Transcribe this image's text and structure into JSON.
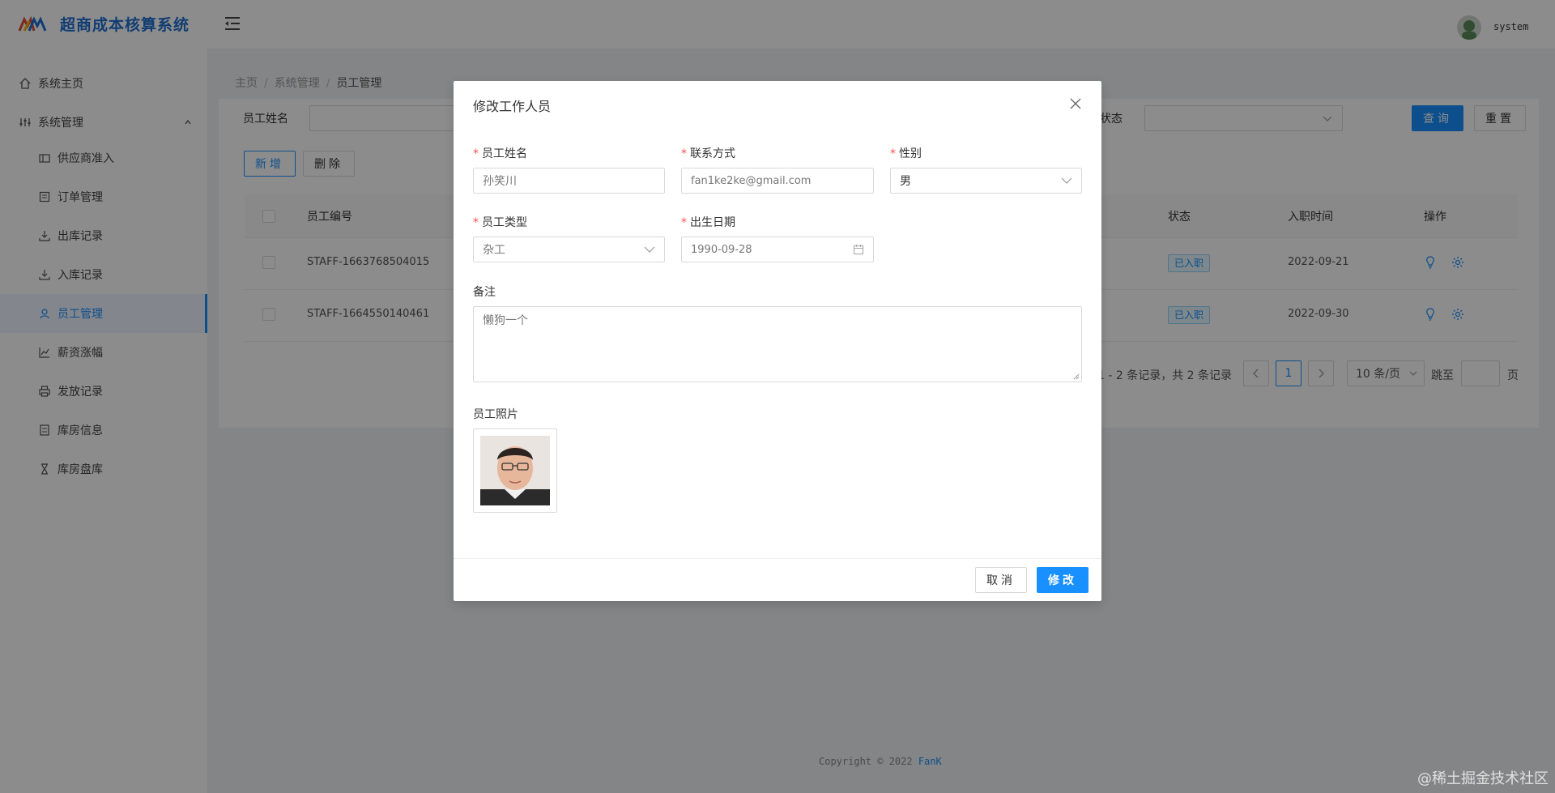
{
  "header": {
    "app_title": "超商成本核算系统",
    "username": "system"
  },
  "sidebar": {
    "items": [
      {
        "label": "系统主页"
      },
      {
        "label": "系统管理"
      },
      {
        "label": "供应商准入"
      },
      {
        "label": "订单管理"
      },
      {
        "label": "出库记录"
      },
      {
        "label": "入库记录"
      },
      {
        "label": "员工管理"
      },
      {
        "label": "薪资涨幅"
      },
      {
        "label": "发放记录"
      },
      {
        "label": "库房信息"
      },
      {
        "label": "库房盘库"
      }
    ],
    "active": "员工管理"
  },
  "breadcrumb": [
    "主页",
    "系统管理",
    "员工管理"
  ],
  "search": {
    "name_label": "员工姓名",
    "status_label": "状态",
    "query_button": "查询",
    "reset_button": "重置"
  },
  "toolbar": {
    "add_button": "新增",
    "delete_button": "删除"
  },
  "table": {
    "columns": [
      "员工编号",
      "状态",
      "入职时间",
      "操作"
    ],
    "rows": [
      {
        "id": "STAFF-1663768504015",
        "status": "已入职",
        "date": "2022-09-21"
      },
      {
        "id": "STAFF-1664550140461",
        "status": "已入职",
        "date": "2022-09-30"
      }
    ]
  },
  "pagination": {
    "summary": "1 - 2 条记录，共 2 条记录",
    "current_page": "1",
    "page_size": "10 条/页",
    "jump_prefix": "跳至",
    "jump_suffix": "页"
  },
  "footer": {
    "copyright": "Copyright © 2022",
    "author": "FanK"
  },
  "modal": {
    "title": "修改工作人员",
    "fields": {
      "name": {
        "label": "员工姓名",
        "value": "孙笑川"
      },
      "contact": {
        "label": "联系方式",
        "value": "fan1ke2ke@gmail.com"
      },
      "gender": {
        "label": "性别",
        "value": "男"
      },
      "type": {
        "label": "员工类型",
        "value": "杂工"
      },
      "birthday": {
        "label": "出生日期",
        "value": "1990-09-28"
      },
      "remark": {
        "label": "备注",
        "value": "懒狗一个"
      },
      "photo": {
        "label": "员工照片"
      }
    },
    "cancel_button": "取消",
    "submit_button": "修改"
  },
  "watermark": "@稀土掘金技术社区",
  "colors": {
    "primary": "#1890ff",
    "brand": "#1f6fd1",
    "required": "#ff4d4f"
  }
}
